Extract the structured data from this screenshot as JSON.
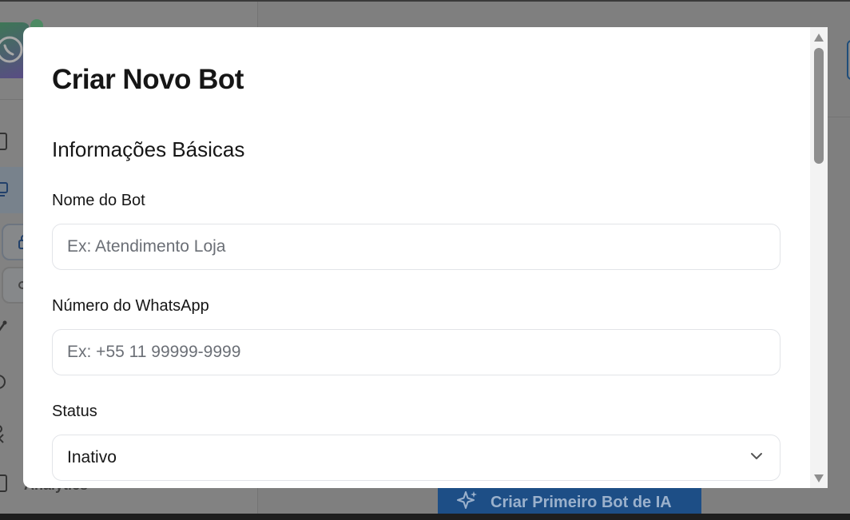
{
  "background": {
    "sidebar_item_label": "Analytics",
    "cta_label": "Criar Primeiro Bot de IA"
  },
  "modal": {
    "title": "Criar Novo Bot",
    "section_title": "Informações Básicas",
    "fields": {
      "bot_name": {
        "label": "Nome do Bot",
        "placeholder": "Ex: Atendimento Loja",
        "value": ""
      },
      "whatsapp_number": {
        "label": "Número do WhatsApp",
        "placeholder": "Ex: +55 11 99999-9999",
        "value": ""
      },
      "status": {
        "label": "Status",
        "value": "Inativo"
      }
    }
  },
  "colors": {
    "overlay": "#7f7f7f",
    "modal_bg": "#ffffff",
    "cta_bg": "#1d4e86",
    "text": "#161616",
    "placeholder": "#6b6f76"
  }
}
